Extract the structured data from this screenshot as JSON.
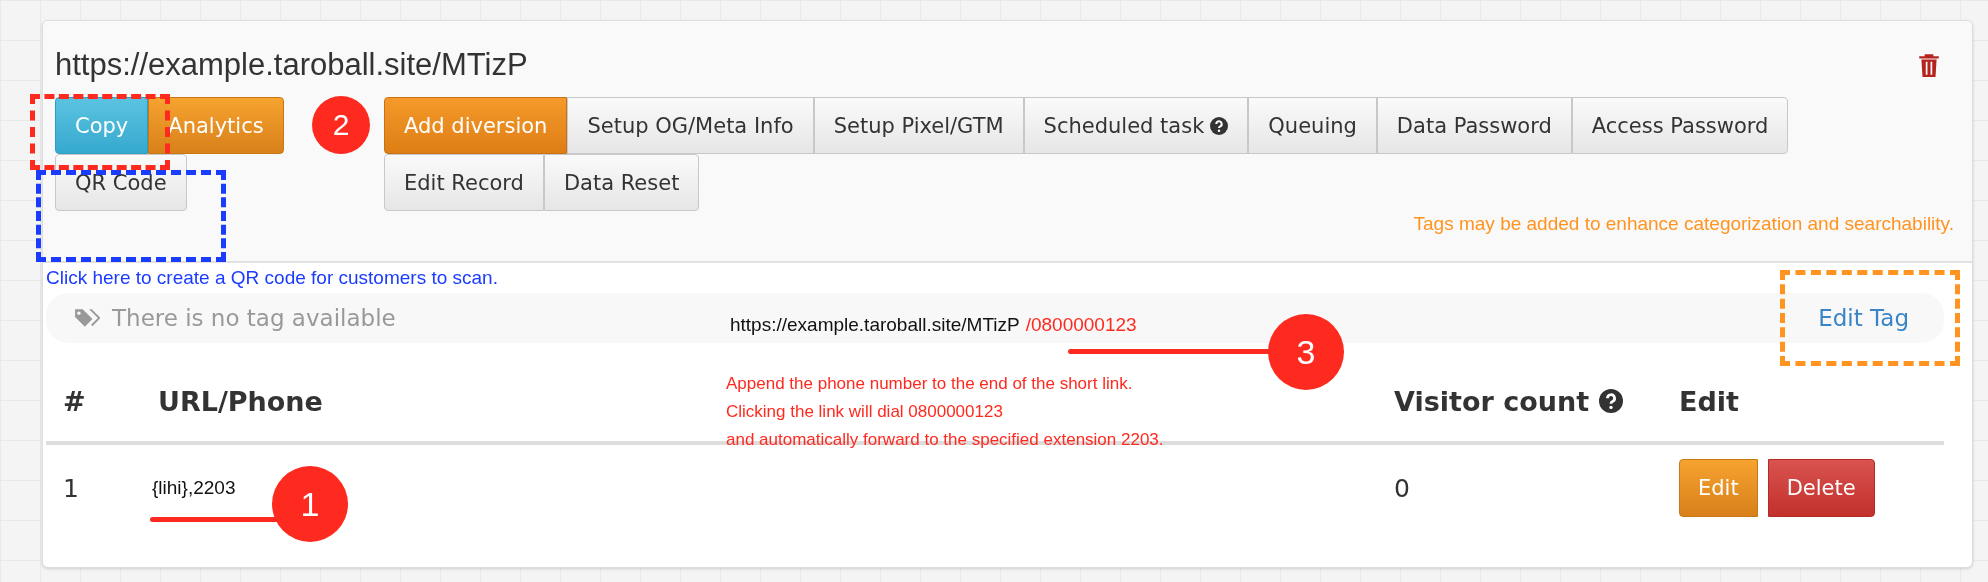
{
  "link": {
    "url": "https://example.taroball.site/MTizP"
  },
  "actions": [
    {
      "label": "Copy",
      "kind": "info"
    },
    {
      "label": "Analytics",
      "kind": "warning"
    }
  ],
  "qr_button": {
    "label": "QR Code"
  },
  "toolbar_rows": [
    [
      {
        "label": "Add diversion",
        "kind": "primary",
        "help": false
      },
      {
        "label": "Setup OG/Meta Info",
        "kind": "default",
        "help": false
      },
      {
        "label": "Setup Pixel/GTM",
        "kind": "default",
        "help": false
      },
      {
        "label": "Scheduled task",
        "kind": "default",
        "help": true
      },
      {
        "label": "Queuing",
        "kind": "default",
        "help": false
      },
      {
        "label": "Data Password",
        "kind": "default",
        "help": false
      },
      {
        "label": "Access Password",
        "kind": "default",
        "help": false
      }
    ],
    [
      {
        "label": "Edit Record",
        "kind": "default",
        "help": false
      },
      {
        "label": "Data Reset",
        "kind": "default",
        "help": false
      }
    ]
  ],
  "tag_hint": "Tags may be added to enhance categorization and searchability.",
  "qr_hint": "Click here to create a QR code for customers to scan.",
  "tags": {
    "empty_text": "There is no tag available",
    "edit_label": "Edit Tag"
  },
  "table": {
    "columns": [
      {
        "label": "#",
        "help": false
      },
      {
        "label": "URL/Phone",
        "help": false
      },
      {
        "label": "Visitor count",
        "help": true
      },
      {
        "label": "Edit",
        "help": false
      }
    ],
    "rows": [
      {
        "index": "1",
        "target": "{lihi},2203",
        "visitors": "0",
        "actions": [
          {
            "label": "Edit",
            "kind": "warning"
          },
          {
            "label": "Delete",
            "kind": "danger"
          }
        ]
      }
    ]
  },
  "annotations": {
    "markers": [
      {
        "number": "1"
      },
      {
        "number": "2"
      },
      {
        "number": "3"
      }
    ],
    "frames": [
      {
        "color": "#ff2a1f"
      },
      {
        "color": "#1a3cff"
      },
      {
        "color": "#ff9420"
      }
    ],
    "example_url": {
      "base": "https://example.taroball.site/MTizP",
      "suffix": "/0800000123"
    },
    "note_lines": [
      "Append the phone number to the end of the short link.",
      "Clicking the link will dial 0800000123",
      "and automatically forward to the specified extension 2203."
    ]
  }
}
